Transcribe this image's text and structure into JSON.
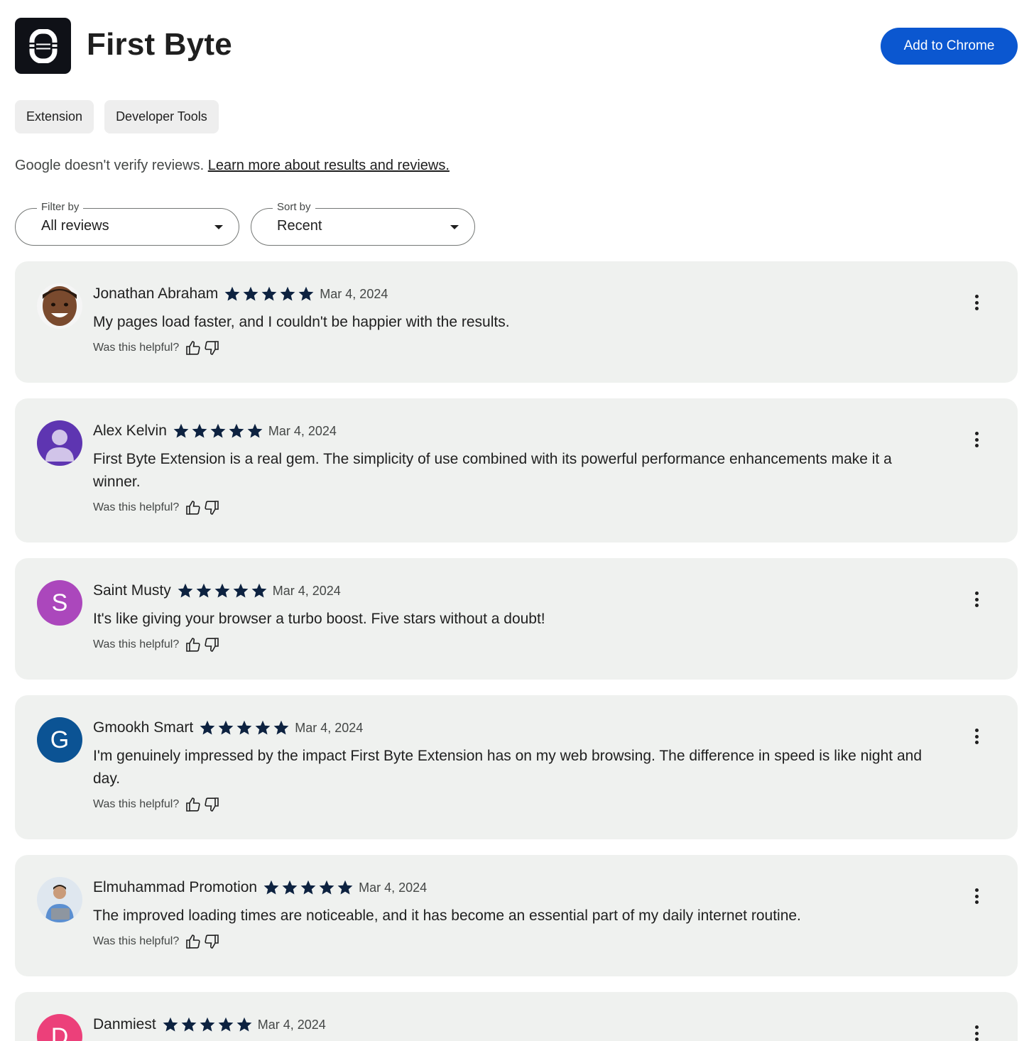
{
  "header": {
    "app_name": "First Byte",
    "add_button": "Add to Chrome"
  },
  "chips": [
    "Extension",
    "Developer Tools"
  ],
  "disclaimer": {
    "text": "Google doesn't verify reviews. ",
    "link": "Learn more about results and reviews."
  },
  "filter": {
    "label": "Filter by",
    "value": "All reviews"
  },
  "sort": {
    "label": "Sort by",
    "value": "Recent"
  },
  "helpful_label": "Was this helpful?",
  "colors": {
    "accent": "#0b57d0",
    "card_bg": "#eff1ef",
    "star": "#0d2240"
  },
  "reviews": [
    {
      "name": "Jonathan Abraham",
      "rating": 5,
      "date": "Mar 4, 2024",
      "text": "My pages load faster, and I couldn't be happier with the results.",
      "avatar_letter": "",
      "avatar_color": "#f5f5f5"
    },
    {
      "name": "Alex Kelvin",
      "rating": 5,
      "date": "Mar 4, 2024",
      "text": "First Byte Extension is a real gem. The simplicity of use combined with its powerful performance enhancements make it a winner.",
      "avatar_letter": "",
      "avatar_color": "#5e35b1"
    },
    {
      "name": "Saint Musty",
      "rating": 5,
      "date": "Mar 4, 2024",
      "text": "It's like giving your browser a turbo boost. Five stars without a doubt!",
      "avatar_letter": "S",
      "avatar_color": "#ab47bc"
    },
    {
      "name": "Gmookh Smart",
      "rating": 5,
      "date": "Mar 4, 2024",
      "text": "I'm genuinely impressed by the impact First Byte Extension has on my web browsing. The difference in speed is like night and day.",
      "avatar_letter": "G",
      "avatar_color": "#0b5394"
    },
    {
      "name": "Elmuhammad Promotion",
      "rating": 5,
      "date": "Mar 4, 2024",
      "text": "The improved loading times are noticeable, and it has become an essential part of my daily internet routine.",
      "avatar_letter": "",
      "avatar_color": "#e8eef5"
    },
    {
      "name": "Danmiest",
      "rating": 5,
      "date": "Mar 4, 2024",
      "text": "",
      "avatar_letter": "D",
      "avatar_color": "#ec407a"
    }
  ]
}
